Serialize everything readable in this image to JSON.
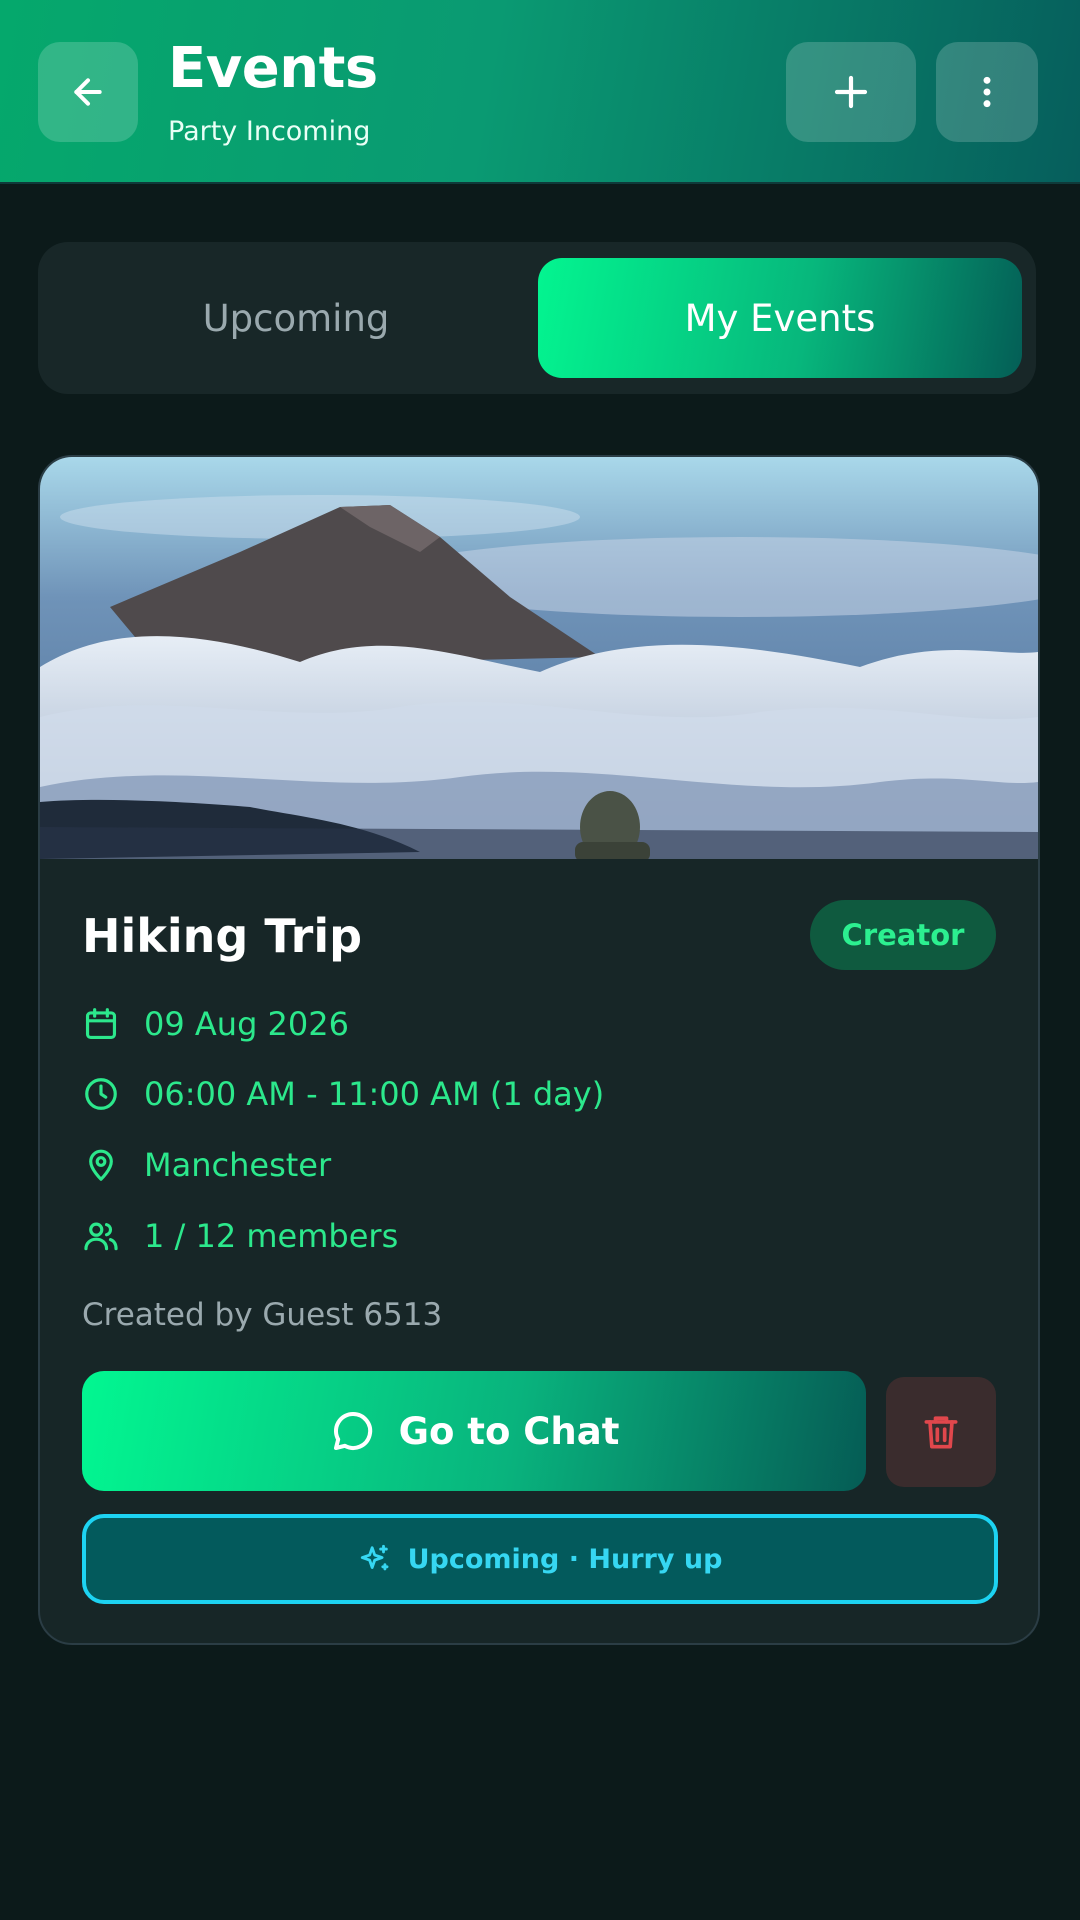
{
  "header": {
    "title": "Events",
    "subtitle": "Party Incoming",
    "back_icon": "arrow-left-icon",
    "add_icon": "plus-icon",
    "more_icon": "more-vertical-icon"
  },
  "tabs": [
    {
      "label": "Upcoming",
      "active": false
    },
    {
      "label": "My Events",
      "active": true
    }
  ],
  "event": {
    "title": "Hiking Trip",
    "badge": "Creator",
    "date": "09 Aug 2026",
    "time": "06:00 AM - 11:00 AM (1 day)",
    "location": "Manchester",
    "members": "1 / 12 members",
    "created_by": "Created by Guest 6513",
    "chat_button": "Go to Chat",
    "status": "Upcoming · Hurry up"
  },
  "colors": {
    "background": "#0c1a1a",
    "accent": "#03f590",
    "accent_text": "#2ce88c",
    "status_cyan": "#1dd3f2",
    "danger": "#e0474c"
  }
}
